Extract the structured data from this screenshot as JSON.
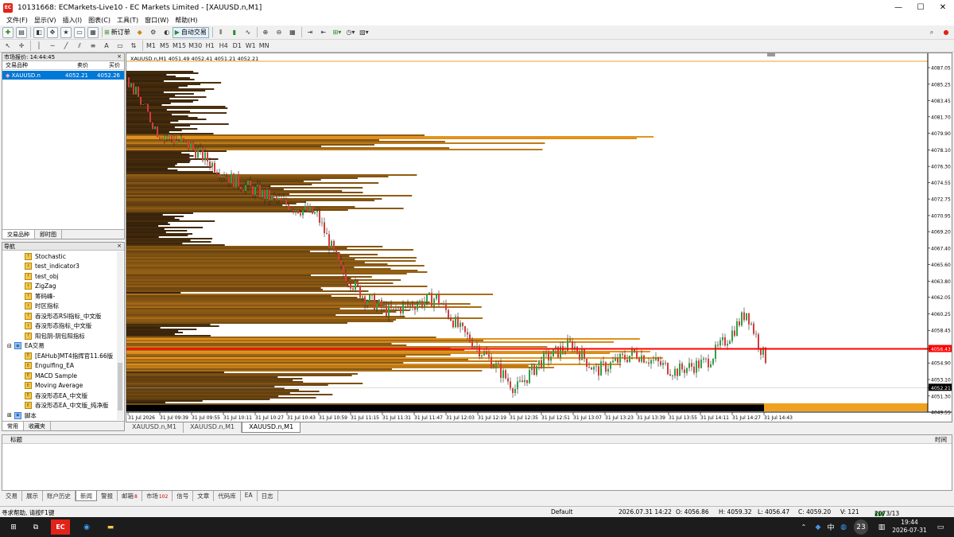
{
  "window": {
    "title": "10131668: ECMarkets-Live10 - EC Markets Limited - [XAUUSD.n,M1]",
    "app_icon": "EC"
  },
  "menu": [
    "文件(F)",
    "显示(V)",
    "插入(I)",
    "图表(C)",
    "工具(T)",
    "窗口(W)",
    "帮助(H)"
  ],
  "toolbar": {
    "new_order": "新订单",
    "auto_trading": "自动交易"
  },
  "timeframes": [
    "M1",
    "M5",
    "M15",
    "M30",
    "H1",
    "H4",
    "D1",
    "W1",
    "MN"
  ],
  "market_watch": {
    "title": "市场报价: 14:44:45",
    "col_symbol": "交易品种",
    "col_bid": "卖价",
    "col_ask": "买价",
    "row": {
      "symbol": "XAUUSD.n",
      "bid": "4052.21",
      "ask": "4052.26"
    },
    "tabs": [
      "交易品种",
      "即时图"
    ]
  },
  "navigator": {
    "title": "导航",
    "items": [
      "Stochastic",
      "test_indicator3",
      "test_obj",
      "ZigZag",
      "筹码峰-",
      "时区指标",
      "吞没形态RSI指标_中文版",
      "吞没形态指标_中文版",
      "阳包阴-阴包阳指标"
    ],
    "ea_group": "EA交易",
    "ea_items": [
      "[EAHub]MT4指挥官11.66版",
      "Engulfing_EA",
      "MACD Sample",
      "Moving Average",
      "吞没形态EA_中文版",
      "吞没形态EA_中文版_纯净版"
    ],
    "scripts": "脚本",
    "tabs": [
      "常用",
      "收藏夹"
    ]
  },
  "chart": {
    "header": "XAUUSD.n,M1  4051.49 4052.41 4051.21 4052.21",
    "price_labels": [
      "4087.05",
      "4085.25",
      "4083.45",
      "4081.70",
      "4079.90",
      "4078.10",
      "4076.30",
      "4074.55",
      "4072.75",
      "4070.95",
      "4069.20",
      "4067.40",
      "4065.60",
      "4063.80",
      "4062.05",
      "4060.25",
      "4058.45",
      "4056.43",
      "4054.90",
      "4053.10",
      "4052.21",
      "4051.30",
      "4049.55"
    ],
    "current_price": "4052.21",
    "hline_price": "4056.43",
    "time_labels": [
      "31 Jul 2026",
      "31 Jul 09:39",
      "31 Jul 09:55",
      "31 Jul 10:11",
      "31 Jul 10:27",
      "31 Jul 10:43",
      "31 Jul 10:59",
      "31 Jul 11:15",
      "31 Jul 11:31",
      "31 Jul 11:47",
      "31 Jul 12:03",
      "31 Jul 12:19",
      "31 Jul 12:35",
      "31 Jul 12:51",
      "31 Jul 13:07",
      "31 Jul 13:23",
      "31 Jul 13:39",
      "31 Jul 13:55",
      "31 Jul 14:11",
      "31 Jul 14:27",
      "31 Jul 14:43"
    ],
    "accent": "#f0a020",
    "hline_color": "#ff0000"
  },
  "chart_tabs": [
    "XAUUSD.n,M1",
    "XAUUSD.n,M1",
    "XAUUSD.n,M1"
  ],
  "terminal": {
    "col_title": "标题",
    "col_time": "时间",
    "tabs": [
      "交易",
      "展示",
      "账户历史",
      "新闻",
      "警报",
      "邮箱",
      "市场",
      "信号",
      "文章",
      "代码库",
      "EA",
      "日志"
    ],
    "mail_count": "8",
    "market_count": "102"
  },
  "status": {
    "help": "寻求帮助, 请按F1键",
    "profile": "Default",
    "datetime": "2026.07.31 14:22",
    "open": "O: 4056.86",
    "high": "H: 4059.32",
    "low": "L: 4056.47",
    "close": "C: 4059.20",
    "volume": "V: 121",
    "traffic": "2073/13 kb"
  },
  "taskbar": {
    "time": "19:44",
    "date": "2026-07-31",
    "ime": "中",
    "badge": "23"
  }
}
